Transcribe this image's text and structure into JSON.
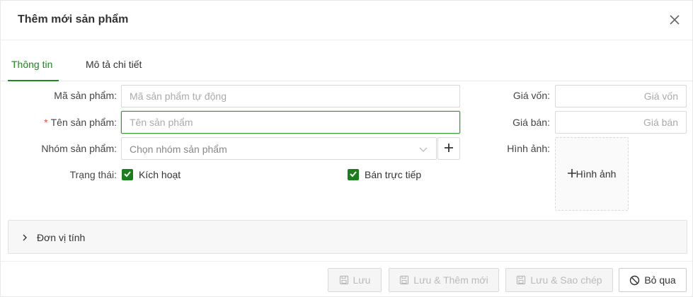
{
  "dialog": {
    "title": "Thêm mới sản phẩm"
  },
  "tabs": [
    {
      "label": "Thông tin",
      "active": true
    },
    {
      "label": "Mô tả chi tiết",
      "active": false
    }
  ],
  "form": {
    "code_label": "Mã sản phẩm",
    "code_placeholder": "Mã sản phẩm tự động",
    "name_label": "Tên sản phẩm",
    "name_required_mark": "*",
    "name_placeholder": "Tên sản phẩm",
    "group_label": "Nhóm sản phẩm",
    "group_placeholder": "Chọn nhóm sản phẩm",
    "status_label": "Trạng thái",
    "active_checkbox_label": "Kích hoạt",
    "active_checked": true,
    "direct_sale_label": "Bán trực tiếp",
    "direct_sale_checked": true,
    "cost_label": "Giá vốn",
    "cost_placeholder": "Giá vốn",
    "price_label": "Giá bán",
    "price_placeholder": "Giá bán",
    "image_label": "Hình ảnh",
    "image_button_label": "Hình ảnh",
    "label_suffix": ":"
  },
  "units_section": {
    "label": "Đơn vị tính"
  },
  "footer": {
    "save_label": "Lưu",
    "save_add_label": "Lưu & Thêm mới",
    "save_copy_label": "Lưu & Sao chép",
    "cancel_label": "Bỏ qua"
  },
  "icons": {
    "close": "close-icon",
    "chevron": "chevron-down-icon",
    "plus": "plus-icon",
    "check": "check-icon",
    "arrow": "chevron-right-icon",
    "save": "save-icon",
    "cancel": "cancel-icon"
  },
  "colors": {
    "accent": "#1a8a1a",
    "checkbox": "#1a7f1a",
    "required": "#e74c3c",
    "focus_border": "#3a9a3a"
  }
}
